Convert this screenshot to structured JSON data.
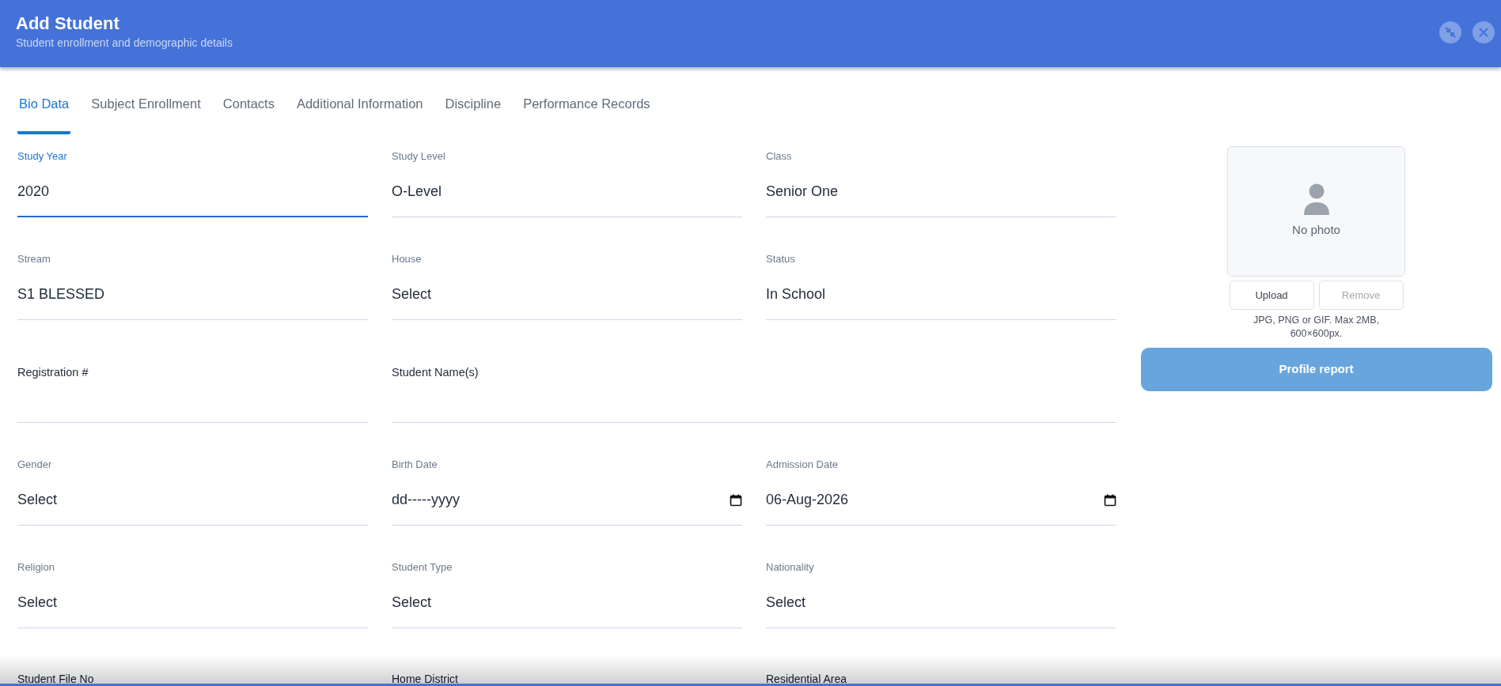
{
  "header": {
    "title": "Add Student",
    "subtitle": "Student enrollment and demographic details"
  },
  "tabs": [
    {
      "label": "Bio Data",
      "selected": true
    },
    {
      "label": "Subject Enrollment",
      "selected": false
    },
    {
      "label": "Contacts",
      "selected": false
    },
    {
      "label": "Additional Information",
      "selected": false
    },
    {
      "label": "Discipline",
      "selected": false
    },
    {
      "label": "Performance Records",
      "selected": false
    }
  ],
  "fields": [
    {
      "kind": "select",
      "label": "Study Year",
      "value": "2020",
      "focused": true
    },
    {
      "kind": "select",
      "label": "Study Level",
      "value": "O-Level",
      "focused": false
    },
    {
      "kind": "select",
      "label": "Class",
      "value": "Senior One",
      "focused": false
    },
    {
      "kind": "select",
      "label": "Stream",
      "value": "S1 BLESSED",
      "focused": false
    },
    {
      "kind": "select",
      "label": "House",
      "value": "Select",
      "focused": false
    },
    {
      "kind": "select",
      "label": "Status",
      "value": "In School",
      "focused": false
    },
    {
      "kind": "text",
      "label": "Registration #",
      "focused": false
    },
    {
      "kind": "text",
      "label": "Student Name(s)",
      "focused": false,
      "wide": true
    },
    {
      "kind": "select",
      "label": "Gender",
      "value": "Select",
      "focused": false
    },
    {
      "kind": "date",
      "label": "Birth Date",
      "value": "dd-----yyyy",
      "focused": false
    },
    {
      "kind": "date",
      "label": "Admission Date",
      "value": "06-Aug-2026",
      "focused": false
    },
    {
      "kind": "select",
      "label": "Religion",
      "value": "Select",
      "focused": false
    },
    {
      "kind": "select",
      "label": "Student Type",
      "value": "Select",
      "focused": false
    },
    {
      "kind": "select",
      "label": "Nationality",
      "value": "Select",
      "focused": false
    },
    {
      "kind": "cut",
      "label": "Student File No"
    },
    {
      "kind": "cut",
      "label": "Home District"
    },
    {
      "kind": "cut",
      "label": "Residential Area"
    }
  ],
  "photo": {
    "placeholder": "No photo",
    "buttons": [
      {
        "label": "Upload",
        "disabled": false
      },
      {
        "label": "Remove",
        "disabled": true
      }
    ],
    "hint": "JPG, PNG or GIF. Max 2MB, 600×600px."
  },
  "profile_button": "Profile report"
}
